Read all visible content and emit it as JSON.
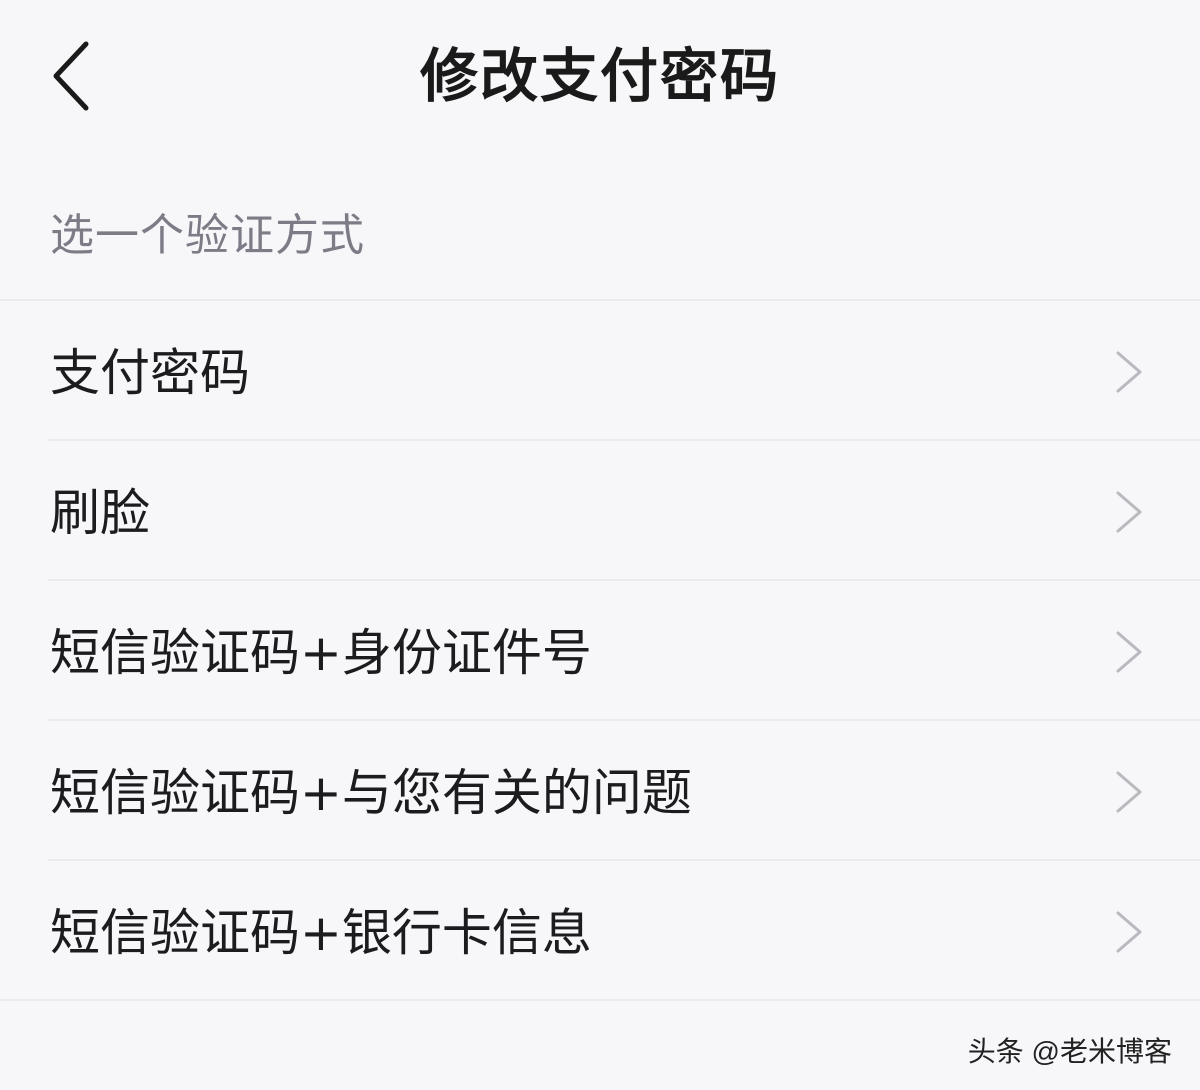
{
  "header": {
    "title": "修改支付密码",
    "back_icon": "chevron-left-icon"
  },
  "section": {
    "label": "选一个验证方式"
  },
  "options": [
    {
      "label": "支付密码",
      "icon": "chevron-right-icon"
    },
    {
      "label": "刷脸",
      "icon": "chevron-right-icon"
    },
    {
      "label": "短信验证码+身份证件号",
      "icon": "chevron-right-icon"
    },
    {
      "label": "短信验证码+与您有关的问题",
      "icon": "chevron-right-icon"
    },
    {
      "label": "短信验证码+银行卡信息",
      "icon": "chevron-right-icon"
    }
  ],
  "watermark": "头条 @老米博客",
  "colors": {
    "background": "#f7f7fa",
    "title_text": "#1a1a1a",
    "section_label": "#7e7b86",
    "chevron": "#b9b9bf",
    "divider": "#ebebef"
  }
}
